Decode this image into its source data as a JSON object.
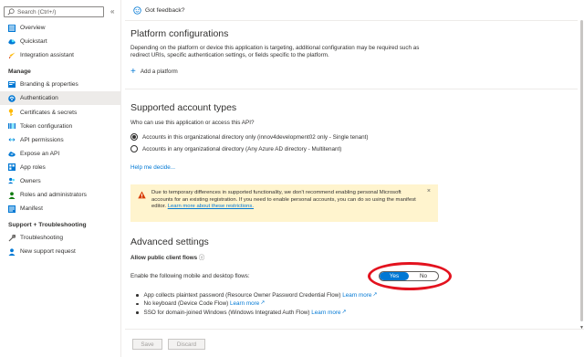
{
  "search": {
    "placeholder": "Search (Ctrl+/)"
  },
  "sidebar": {
    "collapse_icon": "double-chevron-left-icon",
    "items_top": [
      {
        "label": "Overview",
        "icon": "grid-icon"
      },
      {
        "label": "Quickstart",
        "icon": "cloud-icon"
      },
      {
        "label": "Integration assistant",
        "icon": "rocket-icon"
      }
    ],
    "manage_heading": "Manage",
    "items_manage": [
      {
        "label": "Branding & properties",
        "icon": "branding-icon"
      },
      {
        "label": "Authentication",
        "icon": "auth-icon",
        "active": true
      },
      {
        "label": "Certificates & secrets",
        "icon": "key-icon"
      },
      {
        "label": "Token configuration",
        "icon": "token-icon"
      },
      {
        "label": "API permissions",
        "icon": "api-permissions-icon"
      },
      {
        "label": "Expose an API",
        "icon": "cloud-api-icon"
      },
      {
        "label": "App roles",
        "icon": "app-roles-icon"
      },
      {
        "label": "Owners",
        "icon": "owners-icon"
      },
      {
        "label": "Roles and administrators",
        "icon": "roles-icon"
      },
      {
        "label": "Manifest",
        "icon": "manifest-icon"
      }
    ],
    "support_heading": "Support + Troubleshooting",
    "items_support": [
      {
        "label": "Troubleshooting",
        "icon": "wrench-icon"
      },
      {
        "label": "New support request",
        "icon": "support-icon"
      }
    ]
  },
  "topbar": {
    "feedback_label": "Got feedback?"
  },
  "platform": {
    "title": "Platform configurations",
    "description_line1": "Depending on the platform or device this application is targeting, additional configuration may be required such as",
    "description_line2": "redirect URIs, specific authentication settings, or fields specific to the platform.",
    "add_label": "Add a platform"
  },
  "accounts": {
    "title": "Supported account types",
    "question": "Who can use this application or access this API?",
    "option1": "Accounts in this organizational directory only (innov4development02 only - Single tenant)",
    "option2": "Accounts in any organizational directory (Any Azure AD directory - Multitenant)",
    "help_link": "Help me decide..."
  },
  "warning": {
    "line1": "Due to temporary differences in supported functionality, we don't recommend enabling personal Microsoft",
    "line2": "accounts for an existing registration. If you need to enable personal accounts, you can do so using the manifest",
    "line3_prefix": "editor. ",
    "line3_link": "Learn more about these restrictions.",
    "close": "×"
  },
  "advanced": {
    "title": "Advanced settings",
    "public_flows_label": "Allow public client flows",
    "info_icon": "ⓘ",
    "enable_label": "Enable the following mobile and desktop flows:",
    "toggle_yes": "Yes",
    "toggle_no": "No",
    "toggle_value": "Yes",
    "bullets": [
      {
        "text": "App collects plaintext password (Resource Owner Password Credential Flow) ",
        "link": "Learn more"
      },
      {
        "text": "No keyboard (Device Code Flow) ",
        "link": "Learn more"
      },
      {
        "text": "SSO for domain-joined Windows (Windows Integrated Auth Flow) ",
        "link": "Learn more"
      }
    ]
  },
  "footer": {
    "save_label": "Save",
    "discard_label": "Discard"
  },
  "colors": {
    "accent": "#0078d4",
    "warning_bg": "#fff4ce",
    "annotation": "#e3121e"
  }
}
